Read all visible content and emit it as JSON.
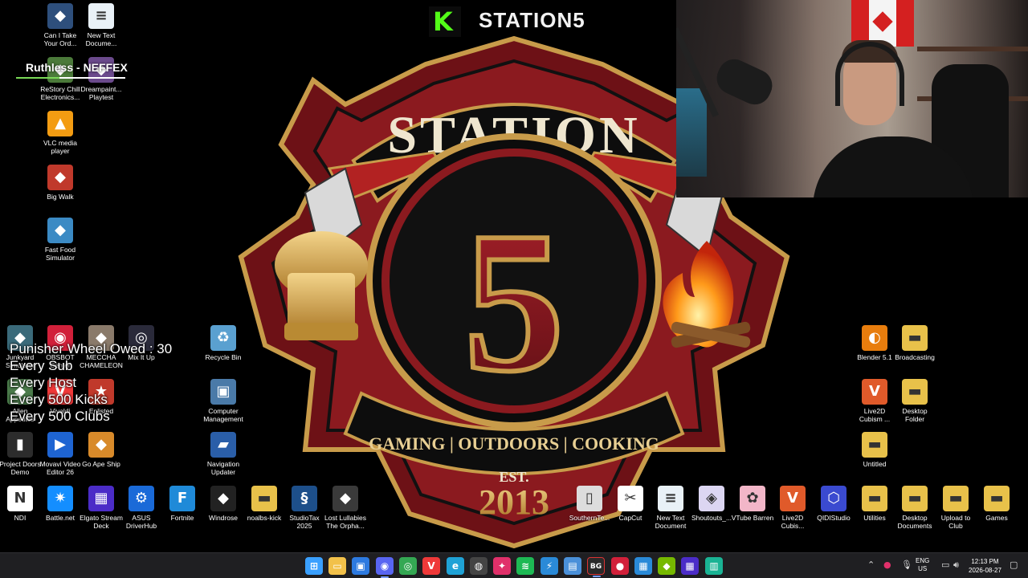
{
  "overlay": {
    "stream_title": "STATION5",
    "now_playing": "Ruthless - NEFFEX",
    "now_playing_progress": 0.4,
    "wheel_lines": [
      "Punisher Wheel Owed : 30",
      "Every Sub",
      "Every Host",
      "Every 500 Kicks",
      "Every 500 Clubs"
    ]
  },
  "wallpaper": {
    "top_text": "STATION",
    "number": "5",
    "banner": "GAMING | OUTDOORS | COOKING",
    "est": "EST.",
    "year": "2013"
  },
  "colors": {
    "accent_kick": "#53fc18",
    "logo_red": "#8b1a1f",
    "logo_gold": "#c89b4a",
    "taskbar_bg": "#1f1f22"
  },
  "desktop_icons": {
    "left_col_top": [
      {
        "label": "Can I Take Your Ord...",
        "icon": "game-icon",
        "color": "#2e4f7c"
      },
      {
        "label": "New Text Docume...",
        "icon": "text-file-icon",
        "color": "#e9f1f7"
      },
      {
        "label": "ReStory Chill Electronics...",
        "icon": "game-icon",
        "color": "#4b7a3a"
      },
      {
        "label": "Dreampaint... Playtest",
        "icon": "game-icon",
        "color": "#6b4a8c"
      },
      {
        "label": "VLC media player",
        "icon": "vlc-icon",
        "color": "#f39c12"
      },
      {
        "label": "Big Walk",
        "icon": "game-icon",
        "color": "#c0392b"
      },
      {
        "label": "Fast Food Simulator",
        "icon": "game-icon",
        "color": "#3b8ac4"
      }
    ],
    "left_block": [
      {
        "label": "Junkyard Simulator",
        "icon": "game-icon",
        "color": "#3a6a7a"
      },
      {
        "label": "OBSBOT Center",
        "icon": "camera-icon",
        "color": "#d1203a"
      },
      {
        "label": "MECCHA CHAMELEON",
        "icon": "game-icon",
        "color": "#8a7a6a"
      },
      {
        "label": "Mix It Up",
        "icon": "fingerprint-icon",
        "color": "#2a2a3a"
      },
      {
        "label": "Recycle Bin",
        "icon": "recycle-bin-icon",
        "color": "#5aa0d0"
      },
      {
        "label": "Alien Appetites",
        "icon": "game-icon",
        "color": "#4a7a4a"
      },
      {
        "label": "Vivaldi",
        "icon": "vivaldi-icon",
        "color": "#ef3939"
      },
      {
        "label": "Enlisted",
        "icon": "star-icon",
        "color": "#c0392b"
      },
      {
        "label": "Computer Management",
        "icon": "computer-icon",
        "color": "#4a7aa8"
      },
      {
        "label": "Project Doors Demo",
        "icon": "door-icon",
        "color": "#2c2c2c"
      },
      {
        "label": "Movavi Video Editor 26",
        "icon": "video-editor-icon",
        "color": "#1e64d2"
      },
      {
        "label": "Go Ape Ship",
        "icon": "game-icon",
        "color": "#d88a2a"
      },
      {
        "label": "Navigation Updater",
        "icon": "car-icon",
        "color": "#2a5ea8"
      }
    ],
    "bottom_row": [
      {
        "label": "NDI",
        "icon": "ndi-icon",
        "color": "#ffffff"
      },
      {
        "label": "Battle.net",
        "icon": "battlenet-icon",
        "color": "#148eff"
      },
      {
        "label": "Elgato Stream Deck",
        "icon": "stream-deck-icon",
        "color": "#4b2cc7"
      },
      {
        "label": "ASUS DriverHub",
        "icon": "gear-icon",
        "color": "#1a6ad8"
      },
      {
        "label": "Fortnite",
        "icon": "fortnite-icon",
        "color": "#1f8ad8"
      },
      {
        "label": "Windrose",
        "icon": "game-icon",
        "color": "#222222"
      },
      {
        "label": "noalbs-kick",
        "icon": "folder-icon",
        "color": "#e8c14a"
      },
      {
        "label": "StudioTax 2025",
        "icon": "tax-icon",
        "color": "#1d4f8a"
      },
      {
        "label": "Lost Lullabies The Orpha...",
        "icon": "game-icon",
        "color": "#3a3a3a"
      },
      {
        "label": "SouthernTe...",
        "icon": "file-icon",
        "color": "#dddddd"
      },
      {
        "label": "CapCut",
        "icon": "capcut-icon",
        "color": "#ffffff"
      },
      {
        "label": "New Text Document",
        "icon": "text-file-icon",
        "color": "#e9f1f7"
      },
      {
        "label": "Shoutouts_...",
        "icon": "shoutouts-icon",
        "color": "#dcd6f2"
      },
      {
        "label": "VTube Barren",
        "icon": "vtube-icon",
        "color": "#f2b6c8"
      },
      {
        "label": "Live2D Cubis...",
        "icon": "live2d-icon",
        "color": "#e05a2a"
      },
      {
        "label": "QIDIStudio",
        "icon": "qidi-icon",
        "color": "#3a4ad0"
      },
      {
        "label": "Utilities",
        "icon": "folder-icon",
        "color": "#e8c14a"
      },
      {
        "label": "Desktop Documents",
        "icon": "folder-icon",
        "color": "#e8c14a"
      },
      {
        "label": "Upload to Club",
        "icon": "folder-icon",
        "color": "#e8c14a"
      },
      {
        "label": "Games",
        "icon": "folder-icon",
        "color": "#e8c14a"
      }
    ],
    "right_col": [
      {
        "label": "Blender 5.1",
        "icon": "blender-icon",
        "color": "#e87d0d"
      },
      {
        "label": "Broadcasting",
        "icon": "folder-icon",
        "color": "#e8c14a"
      },
      {
        "label": "Live2D Cubism ...",
        "icon": "live2d-icon",
        "color": "#e05a2a"
      },
      {
        "label": "Desktop Folder",
        "icon": "folder-icon",
        "color": "#e8c14a"
      },
      {
        "label": "Untitled",
        "icon": "folder-icon",
        "color": "#e8c14a"
      }
    ]
  },
  "taskbar": {
    "apps": [
      {
        "name": "windows-start-icon",
        "glyph": "⊞",
        "color": "#3aa0ff"
      },
      {
        "name": "file-explorer-icon",
        "glyph": "▭",
        "color": "#f2c14a"
      },
      {
        "name": "store-icon",
        "glyph": "▣",
        "color": "#2d7ae0"
      },
      {
        "name": "discord-icon",
        "glyph": "◉",
        "color": "#5865f2"
      },
      {
        "name": "chrome-icon",
        "glyph": "◎",
        "color": "#34a853"
      },
      {
        "name": "vivaldi-icon",
        "glyph": "V",
        "color": "#ef3939"
      },
      {
        "name": "edge-icon",
        "glyph": "e",
        "color": "#1fa2d6"
      },
      {
        "name": "obs-icon",
        "glyph": "◍",
        "color": "#444444"
      },
      {
        "name": "app-icon",
        "glyph": "✦",
        "color": "#e0306a"
      },
      {
        "name": "spotify-icon",
        "glyph": "≋",
        "color": "#1db954"
      },
      {
        "name": "app-icon",
        "glyph": "⚡",
        "color": "#2a8ad8"
      },
      {
        "name": "notepad-icon",
        "glyph": "▤",
        "color": "#4a90d9"
      },
      {
        "name": "bg-icon",
        "glyph": "BG",
        "color": "#2a2a2a"
      },
      {
        "name": "obsbot-icon",
        "glyph": "●",
        "color": "#d1203a"
      },
      {
        "name": "app-icon",
        "glyph": "▦",
        "color": "#2a8ad8"
      },
      {
        "name": "nvidia-icon",
        "glyph": "◆",
        "color": "#76b900"
      },
      {
        "name": "stream-deck-icon",
        "glyph": "▦",
        "color": "#4b2cc7"
      },
      {
        "name": "audio-icon",
        "glyph": "▥",
        "color": "#1ab394"
      }
    ],
    "tray": {
      "lang_top": "ENG",
      "lang_bottom": "US",
      "time": "12:13 PM",
      "date": "2026-08-27"
    }
  }
}
